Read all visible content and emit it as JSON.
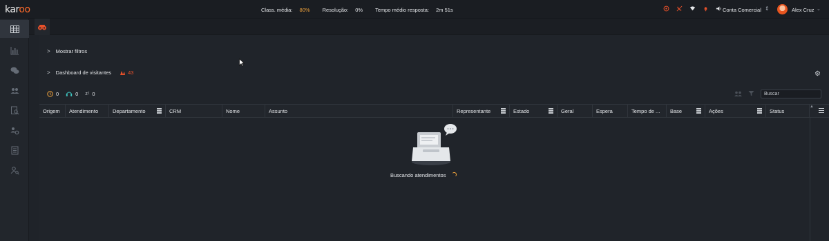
{
  "topbar": {
    "logo_prefix": "kar",
    "logo_suffix": "oo",
    "metrics": [
      {
        "label": "Class. média:",
        "value": "80%"
      },
      {
        "label": "Resolução:",
        "value": "0%"
      },
      {
        "label": "Tempo médio resposta:",
        "value": "2m 51s"
      }
    ],
    "account": "Conta Comercial",
    "user": "Alex Cruz",
    "icons": [
      "whatsapp-icon",
      "phone-off-icon",
      "wifi-icon",
      "bell-icon",
      "volume-icon"
    ]
  },
  "sidebar": {
    "items": [
      {
        "name": "table-icon",
        "active": true
      },
      {
        "name": "bar-chart-icon"
      },
      {
        "name": "chat-icon"
      },
      {
        "name": "users-icon"
      },
      {
        "name": "report-search-icon"
      },
      {
        "name": "settings-users-icon"
      },
      {
        "name": "list-doc-icon"
      },
      {
        "name": "user-search-icon"
      }
    ]
  },
  "filters": {
    "show_filters": "Mostrar filtros",
    "dashboard_label": "Dashboard de visitantes",
    "dashboard_count": "43"
  },
  "counters": {
    "waiting": "0",
    "in_service": "0",
    "idle": "0"
  },
  "search": {
    "placeholder": "Buscar"
  },
  "table": {
    "columns": [
      "Origem",
      "Atendimento",
      "Departamento",
      "CRM",
      "Nome",
      "Assunto",
      "Representante",
      "Estado",
      "Geral",
      "Espera",
      "Tempo de ...",
      "Base",
      "Ações",
      "Status"
    ]
  },
  "empty_state": {
    "label": "Buscando atendimentos"
  },
  "colors": {
    "accent": "#ff6a2a",
    "warning": "#f0a33c",
    "danger": "#e8512a"
  }
}
